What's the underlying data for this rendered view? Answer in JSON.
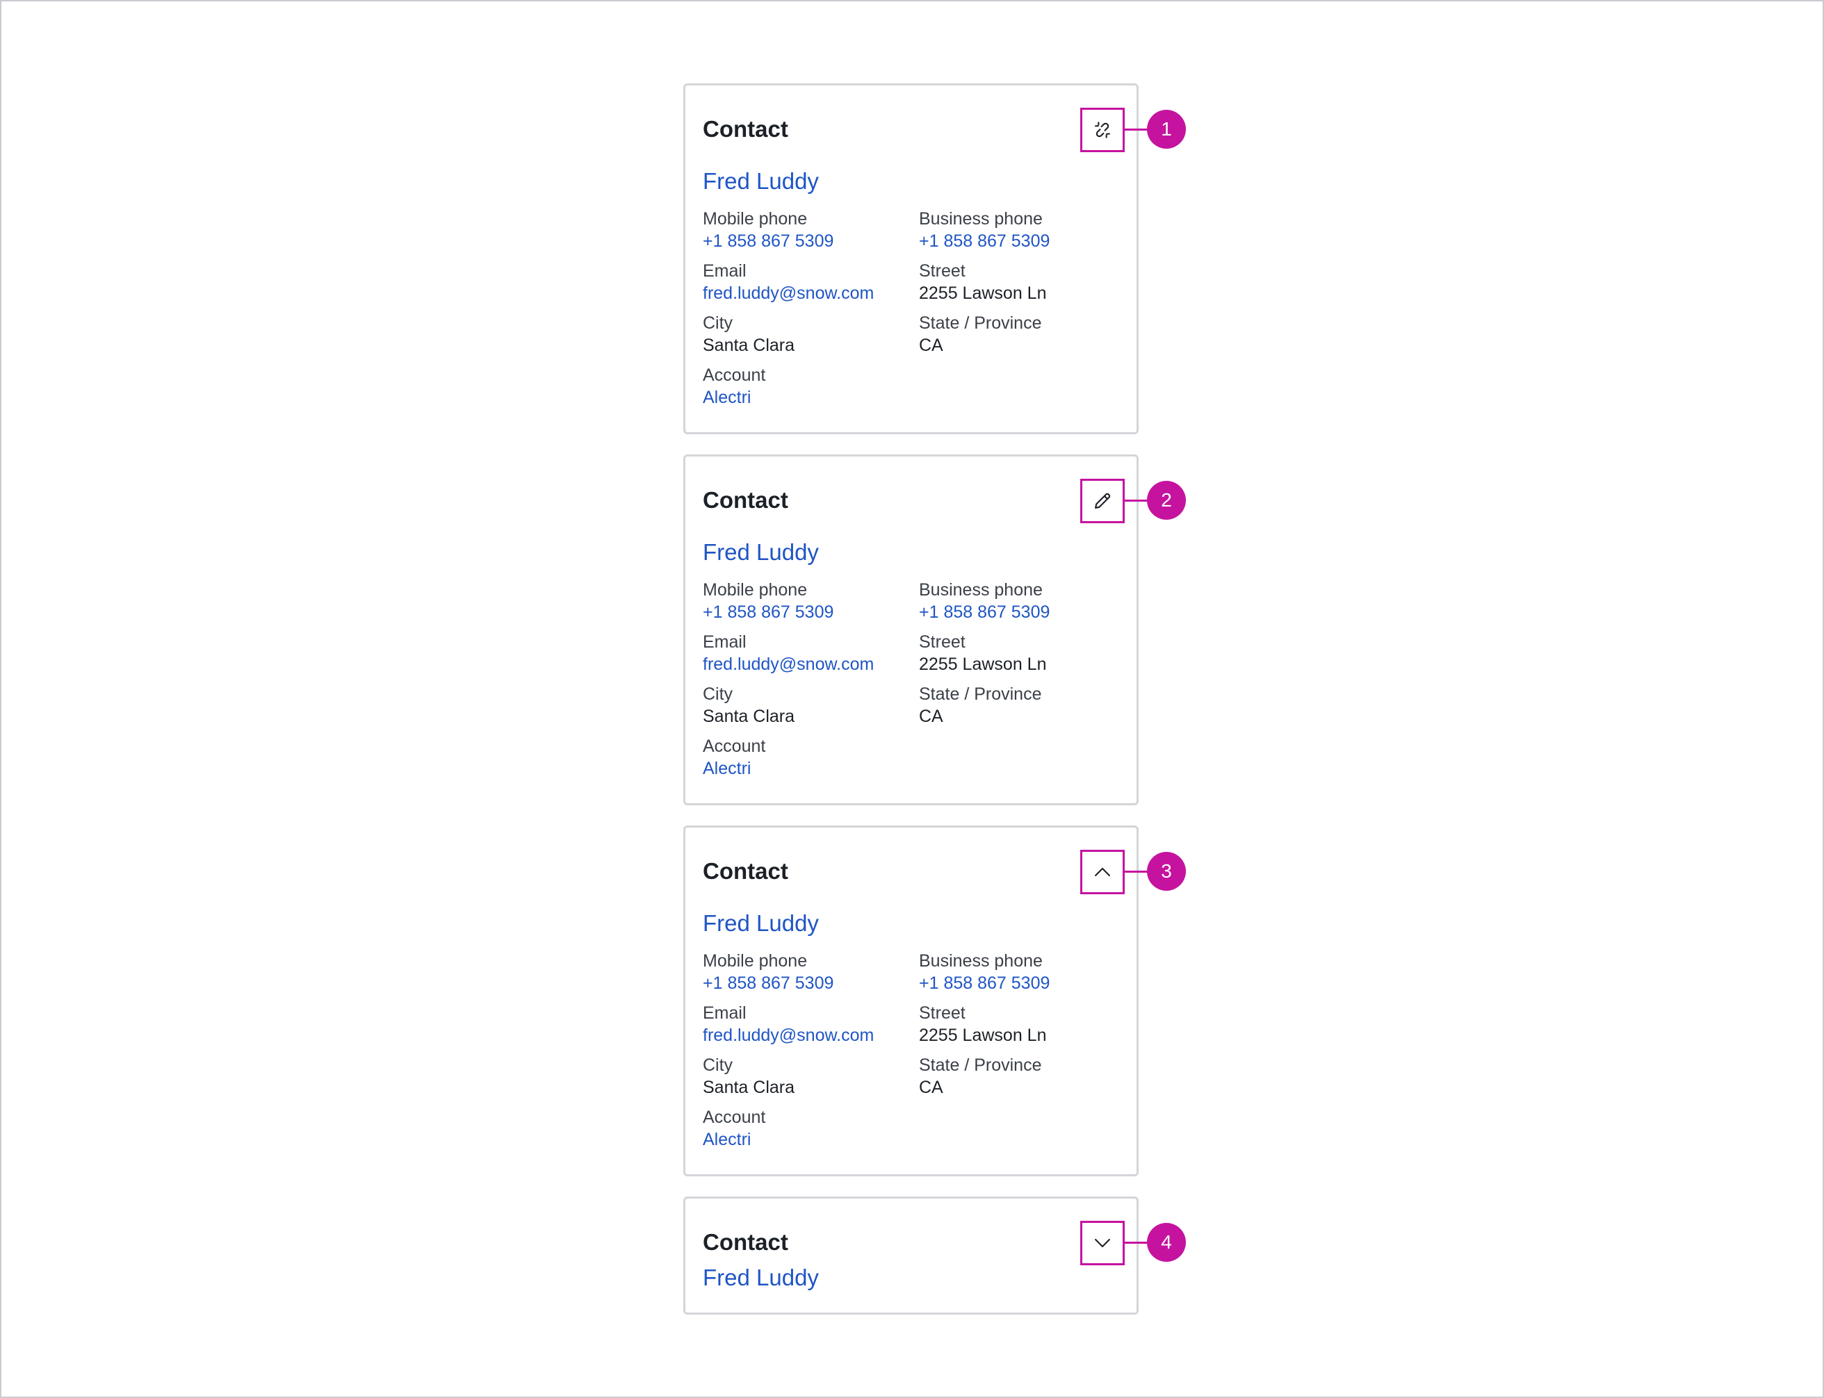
{
  "cards": [
    {
      "title": "Contact",
      "name": "Fred Luddy",
      "action_icon": "unlink-icon",
      "callout": "1",
      "fields": [
        {
          "label": "Mobile phone",
          "value": "+1 858 867 5309"
        },
        {
          "label": "Business phone",
          "value": "+1 858 867 5309"
        },
        {
          "label": "Email",
          "value": "fred.luddy@snow.com"
        },
        {
          "label": "Street",
          "value": "2255 Lawson Ln"
        },
        {
          "label": "City",
          "value": "Santa Clara"
        },
        {
          "label": "State / Province",
          "value": "CA"
        },
        {
          "label": "Account",
          "value": "Alectri"
        }
      ]
    },
    {
      "title": "Contact",
      "name": "Fred Luddy",
      "action_icon": "pencil-icon",
      "callout": "2",
      "fields": [
        {
          "label": "Mobile phone",
          "value": "+1 858 867 5309"
        },
        {
          "label": "Business phone",
          "value": "+1 858 867 5309"
        },
        {
          "label": "Email",
          "value": "fred.luddy@snow.com"
        },
        {
          "label": "Street",
          "value": "2255 Lawson Ln"
        },
        {
          "label": "City",
          "value": "Santa Clara"
        },
        {
          "label": "State / Province",
          "value": "CA"
        },
        {
          "label": "Account",
          "value": "Alectri"
        }
      ]
    },
    {
      "title": "Contact",
      "name": "Fred Luddy",
      "action_icon": "chevron-up-icon",
      "callout": "3",
      "fields": [
        {
          "label": "Mobile phone",
          "value": "+1 858 867 5309"
        },
        {
          "label": "Business phone",
          "value": "+1 858 867 5309"
        },
        {
          "label": "Email",
          "value": "fred.luddy@snow.com"
        },
        {
          "label": "Street",
          "value": "2255 Lawson Ln"
        },
        {
          "label": "City",
          "value": "Santa Clara"
        },
        {
          "label": "State / Province",
          "value": "CA"
        },
        {
          "label": "Account",
          "value": "Alectri"
        }
      ]
    },
    {
      "title": "Contact",
      "name": "Fred Luddy",
      "action_icon": "chevron-down-icon",
      "callout": "4"
    }
  ],
  "colors": {
    "accent": "#c5139f",
    "link": "#1f55c4",
    "text": "#1c2127",
    "label": "#3b4048",
    "border": "#d3d5d9"
  }
}
